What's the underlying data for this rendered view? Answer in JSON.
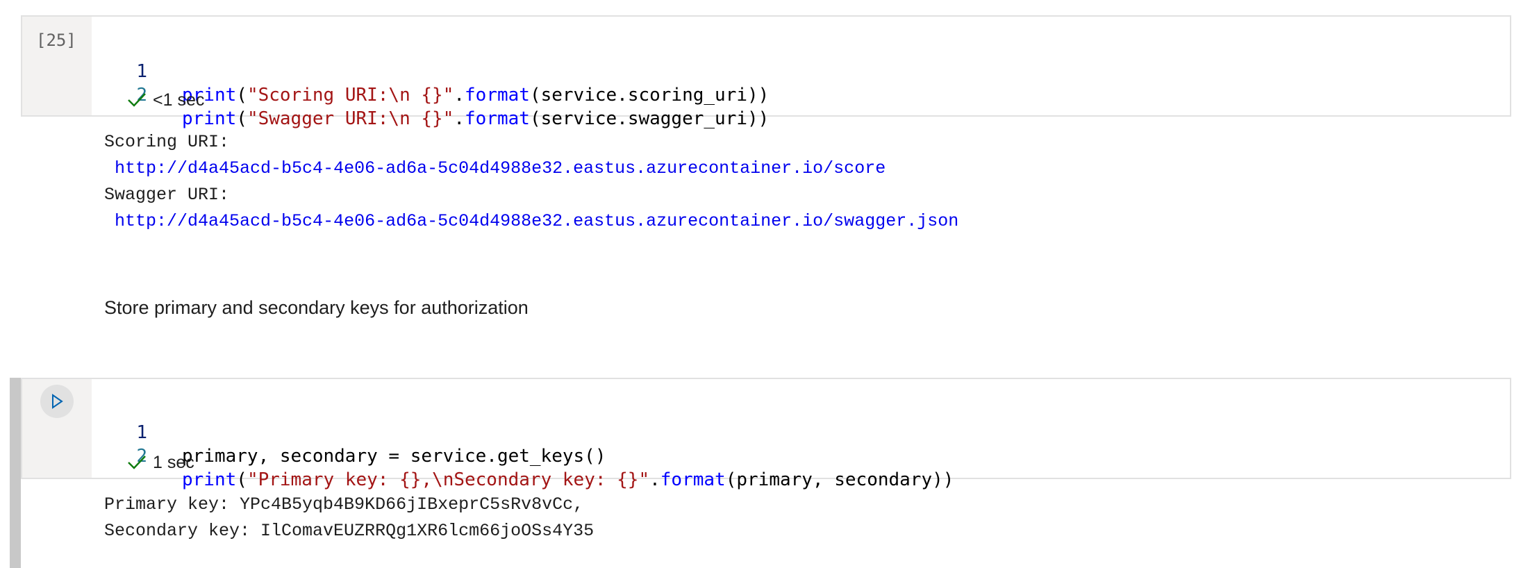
{
  "cell1": {
    "execution_count": "[25]",
    "lines": [
      {
        "num": "1",
        "tokens": [
          {
            "t": "print",
            "c": "kw"
          },
          {
            "t": "(",
            "c": ""
          },
          {
            "t": "\"Scoring URI:\\n {}\"",
            "c": "str"
          },
          {
            "t": ".",
            "c": ""
          },
          {
            "t": "format",
            "c": "kw"
          },
          {
            "t": "(service.scoring_uri))",
            "c": ""
          }
        ]
      },
      {
        "num": "2",
        "tokens": [
          {
            "t": "print",
            "c": "kw"
          },
          {
            "t": "(",
            "c": ""
          },
          {
            "t": "\"Swagger URI:\\n {}\"",
            "c": "str"
          },
          {
            "t": ".",
            "c": ""
          },
          {
            "t": "format",
            "c": "kw"
          },
          {
            "t": "(service.swagger_uri))",
            "c": ""
          }
        ]
      }
    ],
    "status": "<1 sec",
    "output": {
      "scoring_label": "Scoring URI:",
      "scoring_url": "http://d4a45acd-b5c4-4e06-ad6a-5c04d4988e32.eastus.azurecontainer.io/score",
      "swagger_label": "Swagger URI:",
      "swagger_url": "http://d4a45acd-b5c4-4e06-ad6a-5c04d4988e32.eastus.azurecontainer.io/swagger.json"
    }
  },
  "markdown": {
    "text": "Store primary and secondary keys for authorization"
  },
  "cell2": {
    "lines": [
      {
        "num": "1",
        "tokens": [
          {
            "t": "primary, secondary = service.get_keys()",
            "c": ""
          }
        ]
      },
      {
        "num": "2",
        "tokens": [
          {
            "t": "print",
            "c": "kw"
          },
          {
            "t": "(",
            "c": ""
          },
          {
            "t": "\"Primary key: {},\\nSecondary key: {}\"",
            "c": "str"
          },
          {
            "t": ".",
            "c": ""
          },
          {
            "t": "format",
            "c": "kw"
          },
          {
            "t": "(primary, secondary))",
            "c": ""
          }
        ]
      }
    ],
    "status": "1 sec",
    "output": {
      "primary": "Primary key: YPc4B5yqb4B9KD66jIBxeprC5sRv8vCc,",
      "secondary": "Secondary key: IlComavEUZRRQg1XR6lcm66joOSs4Y35"
    }
  },
  "colors": {
    "keyword": "#0000ff",
    "string": "#a31515",
    "line_number": "#237893",
    "link": "#0000ee",
    "check": "#107c10"
  },
  "icons": {
    "run": "run-cell-icon",
    "check": "checkmark-icon"
  }
}
